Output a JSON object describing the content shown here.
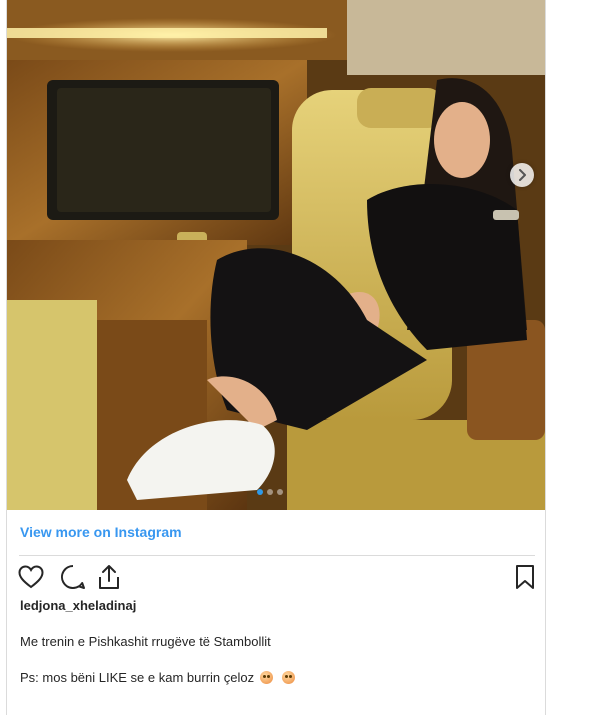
{
  "post": {
    "view_more_label": "View more on Instagram",
    "username": "ledjona_xheladinaj",
    "caption_line1": "Me trenin e Pishkashit rrugëve të Stambollit",
    "caption_line2": "Ps: mos bëni LIKE se e kam burrin çeloz",
    "caption_emojis": [
      "flushed-face-emoji",
      "flushed-face-emoji"
    ]
  },
  "carousel": {
    "current_slide": 1,
    "total_slides": 3,
    "next_icon": "chevron-right-icon"
  },
  "actions": {
    "like_icon": "heart-icon",
    "comment_icon": "comment-icon",
    "share_icon": "share-icon",
    "save_icon": "bookmark-icon"
  },
  "colors": {
    "link": "#3897f0",
    "active_dot": "#2f9ae8",
    "divider": "#dbdbdb",
    "text": "#262626"
  }
}
